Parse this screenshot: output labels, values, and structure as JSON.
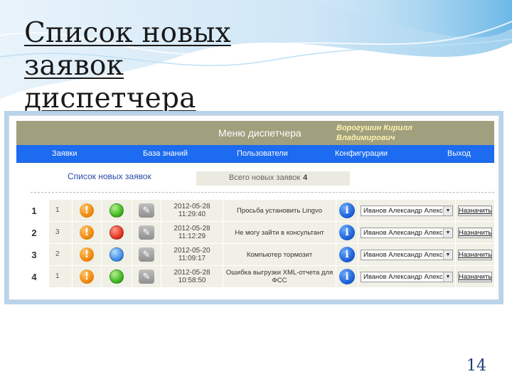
{
  "slide": {
    "title_line1": "Список новых заявок",
    "title_line2": "диспетчера",
    "page_number": "14"
  },
  "app": {
    "menu_title": "Меню диспетчера",
    "user_name": "Ворогушин Кирилл Владимирович",
    "nav": [
      "Заявки",
      "База знаний",
      "Пользователи",
      "Конфигурации",
      "Выход"
    ],
    "list_heading": "Список новых заявок",
    "count_label": "Всего новых заявок",
    "count_value": "4",
    "assign_label": "Назначить"
  },
  "rows": [
    {
      "num": "1",
      "priority": "1",
      "status": "green",
      "date": "2012-05-28",
      "time": "11:29:40",
      "text": "Просьба установить Lingvo",
      "assignee": "Иванов Александр Александ"
    },
    {
      "num": "2",
      "priority": "3",
      "status": "red",
      "date": "2012-05-28",
      "time": "11:12:29",
      "text": "Не могу зайти в консультант",
      "assignee": "Иванов Александр Александ"
    },
    {
      "num": "3",
      "priority": "2",
      "status": "blue",
      "date": "2012-05-20",
      "time": "11:09:17",
      "text": "Компьютер тормозит",
      "assignee": "Иванов Александр Александ"
    },
    {
      "num": "4",
      "priority": "1",
      "status": "green",
      "date": "2012-05-28",
      "time": "10:58:50",
      "text": "Ошибка выгрузки XML-отчета для ФСС",
      "assignee": "Иванов Александр Александ"
    }
  ],
  "colors": {
    "topbar": "#a09f7e",
    "navbar": "#1c6bf0",
    "frame": "#b9d3ea",
    "page_number": "#1f3e7a"
  },
  "icons": {
    "warning": "exclamation-circle",
    "attachment": "paperclip",
    "info": "info-circle"
  }
}
